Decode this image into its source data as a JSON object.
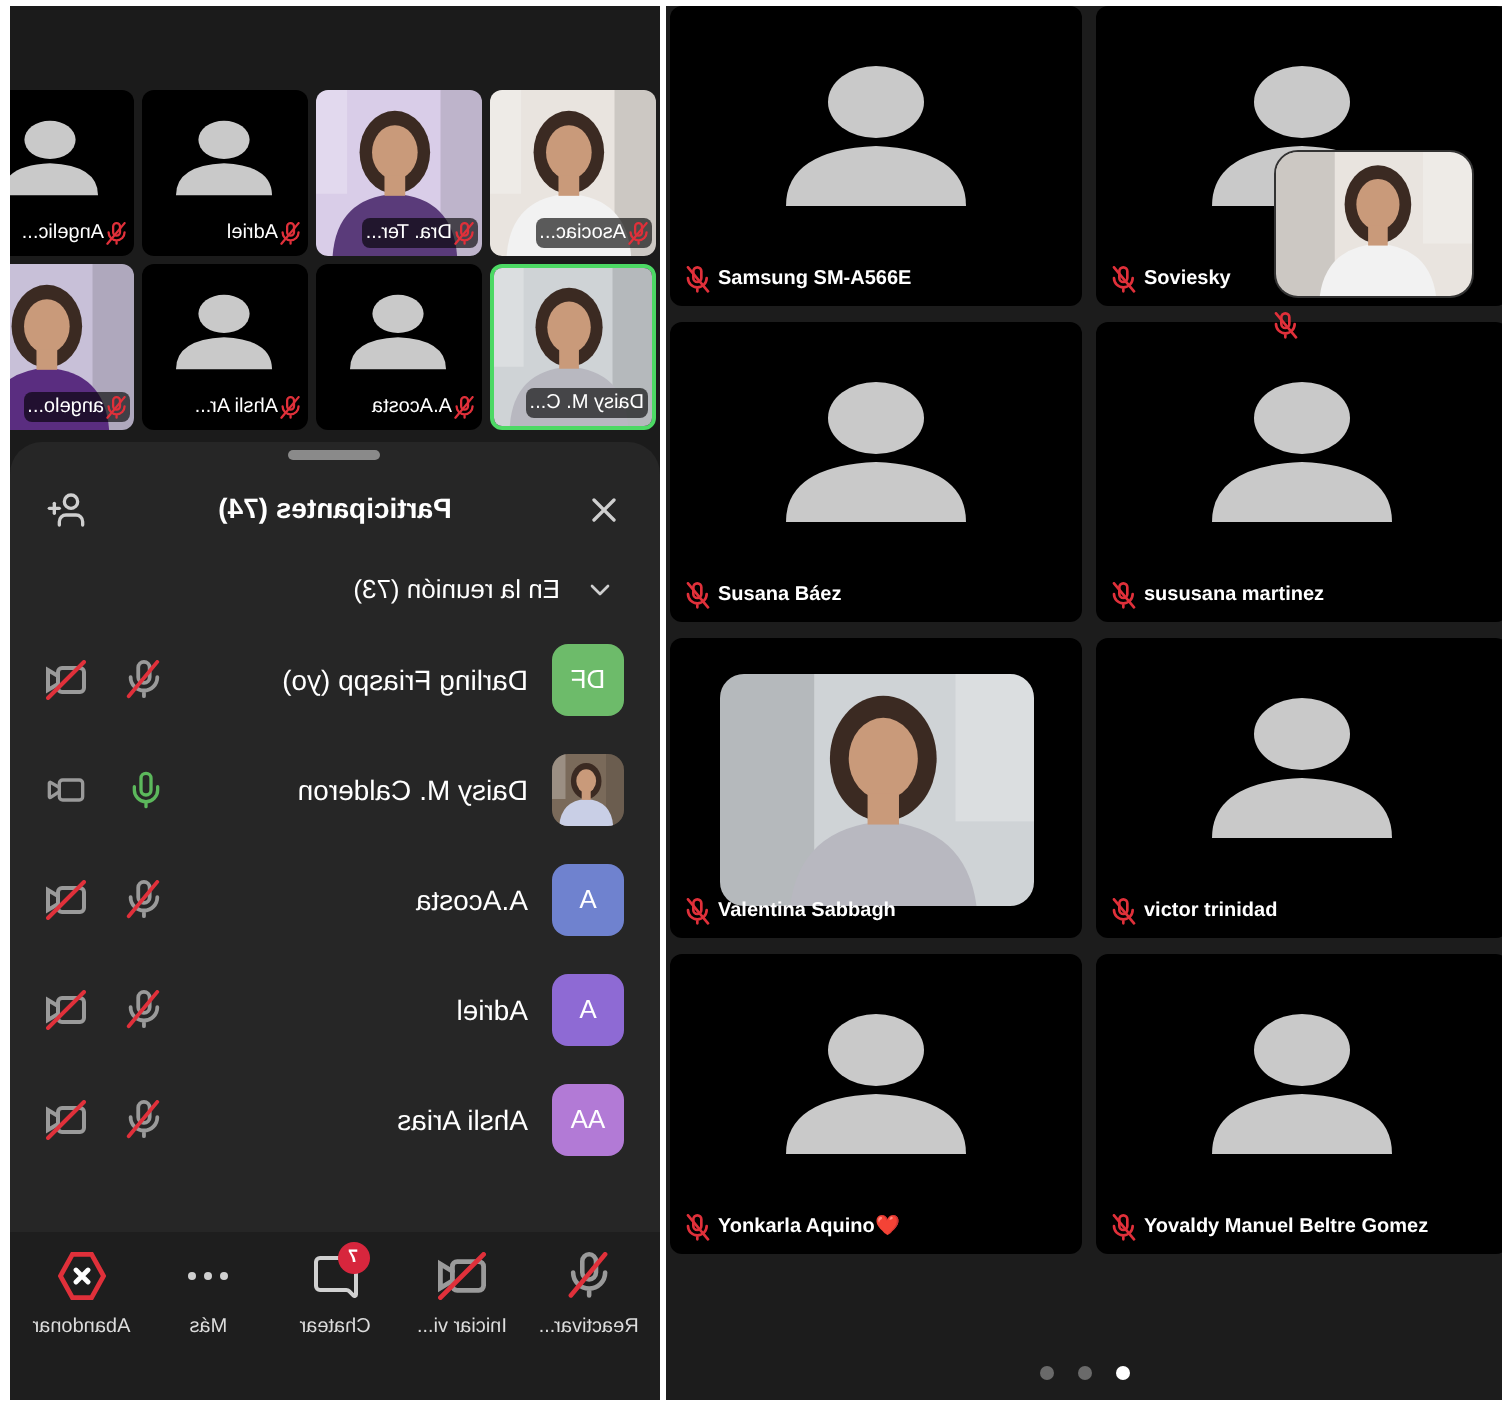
{
  "left_screen": {
    "mirrored": true,
    "thumbnails": [
      {
        "name": "Angelic...",
        "kind": "avatar",
        "muted": true,
        "highlighted": false
      },
      {
        "name": "Adriel",
        "kind": "avatar",
        "muted": true,
        "highlighted": false
      },
      {
        "name": "Dra. Ter...",
        "kind": "video",
        "muted": true,
        "highlighted": false
      },
      {
        "name": "Asociac...",
        "kind": "video",
        "muted": true,
        "highlighted": false
      },
      {
        "name": "angelo...",
        "kind": "video",
        "muted": true,
        "highlighted": false
      },
      {
        "name": "Ahsli Ar...",
        "kind": "avatar",
        "muted": true,
        "highlighted": false
      },
      {
        "name": "A.Acosta",
        "kind": "avatar",
        "muted": true,
        "highlighted": false
      },
      {
        "name": "Daisy M. C...",
        "kind": "video",
        "muted": false,
        "highlighted": true
      }
    ],
    "participants_panel": {
      "title": "Participantes (74)",
      "section": {
        "label": "En la reunión (73)",
        "expanded": true
      },
      "participants": [
        {
          "initials": "DF",
          "name": "Darling Friaspp (yo)",
          "color": "#6dbb6a",
          "kind": "initials",
          "mic_on": false,
          "camera_on": false
        },
        {
          "name": "Daisy M. Calderon",
          "kind": "picture",
          "mic_on": true,
          "camera_on": true
        },
        {
          "initials": "A",
          "name": "A.Acosta",
          "color": "#6f82cf",
          "kind": "initials",
          "mic_on": false,
          "camera_on": false
        },
        {
          "initials": "A",
          "name": "Adriel",
          "color": "#8e6ad4",
          "kind": "initials",
          "mic_on": false,
          "camera_on": false
        },
        {
          "initials": "AA",
          "name": "Ahsli Arias",
          "color": "#b27ad6",
          "kind": "initials",
          "mic_on": false,
          "camera_on": false
        }
      ]
    },
    "toolbar": [
      {
        "label": "Abandonar",
        "kind": "leave"
      },
      {
        "label": "Más",
        "kind": "more"
      },
      {
        "label": "Chatear",
        "kind": "chat",
        "badge": "7"
      },
      {
        "label": "Iniciar vi...",
        "kind": "video"
      },
      {
        "label": "Reactivar...",
        "kind": "mic"
      }
    ]
  },
  "right_screen": {
    "tiles": [
      {
        "name": "Samsung SM-A566E",
        "kind": "avatar",
        "muted": true
      },
      {
        "name": "Soviesky",
        "kind": "avatar",
        "muted": true
      },
      {
        "name": "Susana Báez",
        "kind": "avatar",
        "muted": true
      },
      {
        "name": "sususana martinez",
        "kind": "avatar",
        "muted": true
      },
      {
        "name": "Valentina Sabbagh",
        "kind": "video",
        "muted": true
      },
      {
        "name": "victor trinidad",
        "kind": "avatar",
        "muted": true
      },
      {
        "name": "Yonkarla Aquino❤️",
        "kind": "avatar",
        "muted": true
      },
      {
        "name": "Yovaldy Manuel Beltre Gomez",
        "kind": "avatar",
        "muted": true
      }
    ],
    "self_view": {
      "kind": "picture",
      "muted": true
    },
    "pager": [
      {
        "selected": false
      },
      {
        "selected": false
      },
      {
        "selected": true
      }
    ]
  }
}
